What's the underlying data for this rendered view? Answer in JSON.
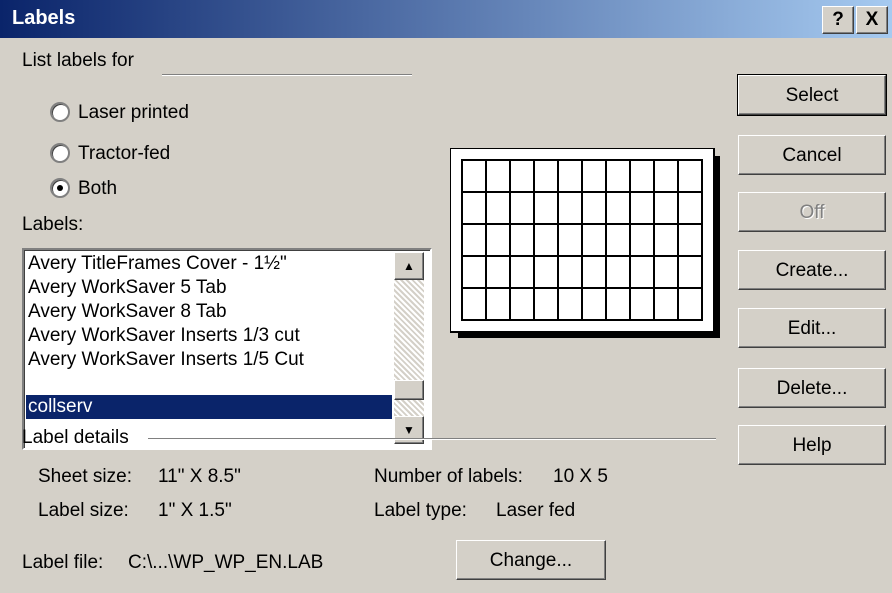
{
  "window": {
    "title": "Labels",
    "help_glyph": "?",
    "close_glyph": "X"
  },
  "list_labels_for": {
    "group_label": "List labels for",
    "options": [
      {
        "label": "Laser printed",
        "selected": false
      },
      {
        "label": "Tractor-fed",
        "selected": false
      },
      {
        "label": "Both",
        "selected": true
      }
    ]
  },
  "labels_list": {
    "label": "Labels:",
    "items": [
      "Avery TitleFrames Cover - 1½\"",
      "Avery WorkSaver 5 Tab",
      "Avery WorkSaver 8 Tab",
      "Avery WorkSaver Inserts 1/3 cut",
      "Avery WorkSaver Inserts 1/5 Cut",
      "collserv"
    ],
    "selected_index": 5
  },
  "preview": {
    "columns": 10,
    "rows": 5
  },
  "buttons": {
    "select": "Select",
    "cancel": "Cancel",
    "off": "Off",
    "create": "Create...",
    "edit": "Edit...",
    "delete": "Delete...",
    "help": "Help",
    "change": "Change..."
  },
  "label_details": {
    "group_label": "Label details",
    "sheet_size_label": "Sheet size:",
    "sheet_size_value": "11\" X 8.5\"",
    "label_size_label": "Label size:",
    "label_size_value": "1\" X 1.5\"",
    "number_of_labels_label": "Number of labels:",
    "number_of_labels_value": "10 X 5",
    "label_type_label": "Label type:",
    "label_type_value": "Laser fed",
    "label_file_label": "Label file:",
    "label_file_value": "C:\\...\\WP_WP_EN.LAB"
  }
}
